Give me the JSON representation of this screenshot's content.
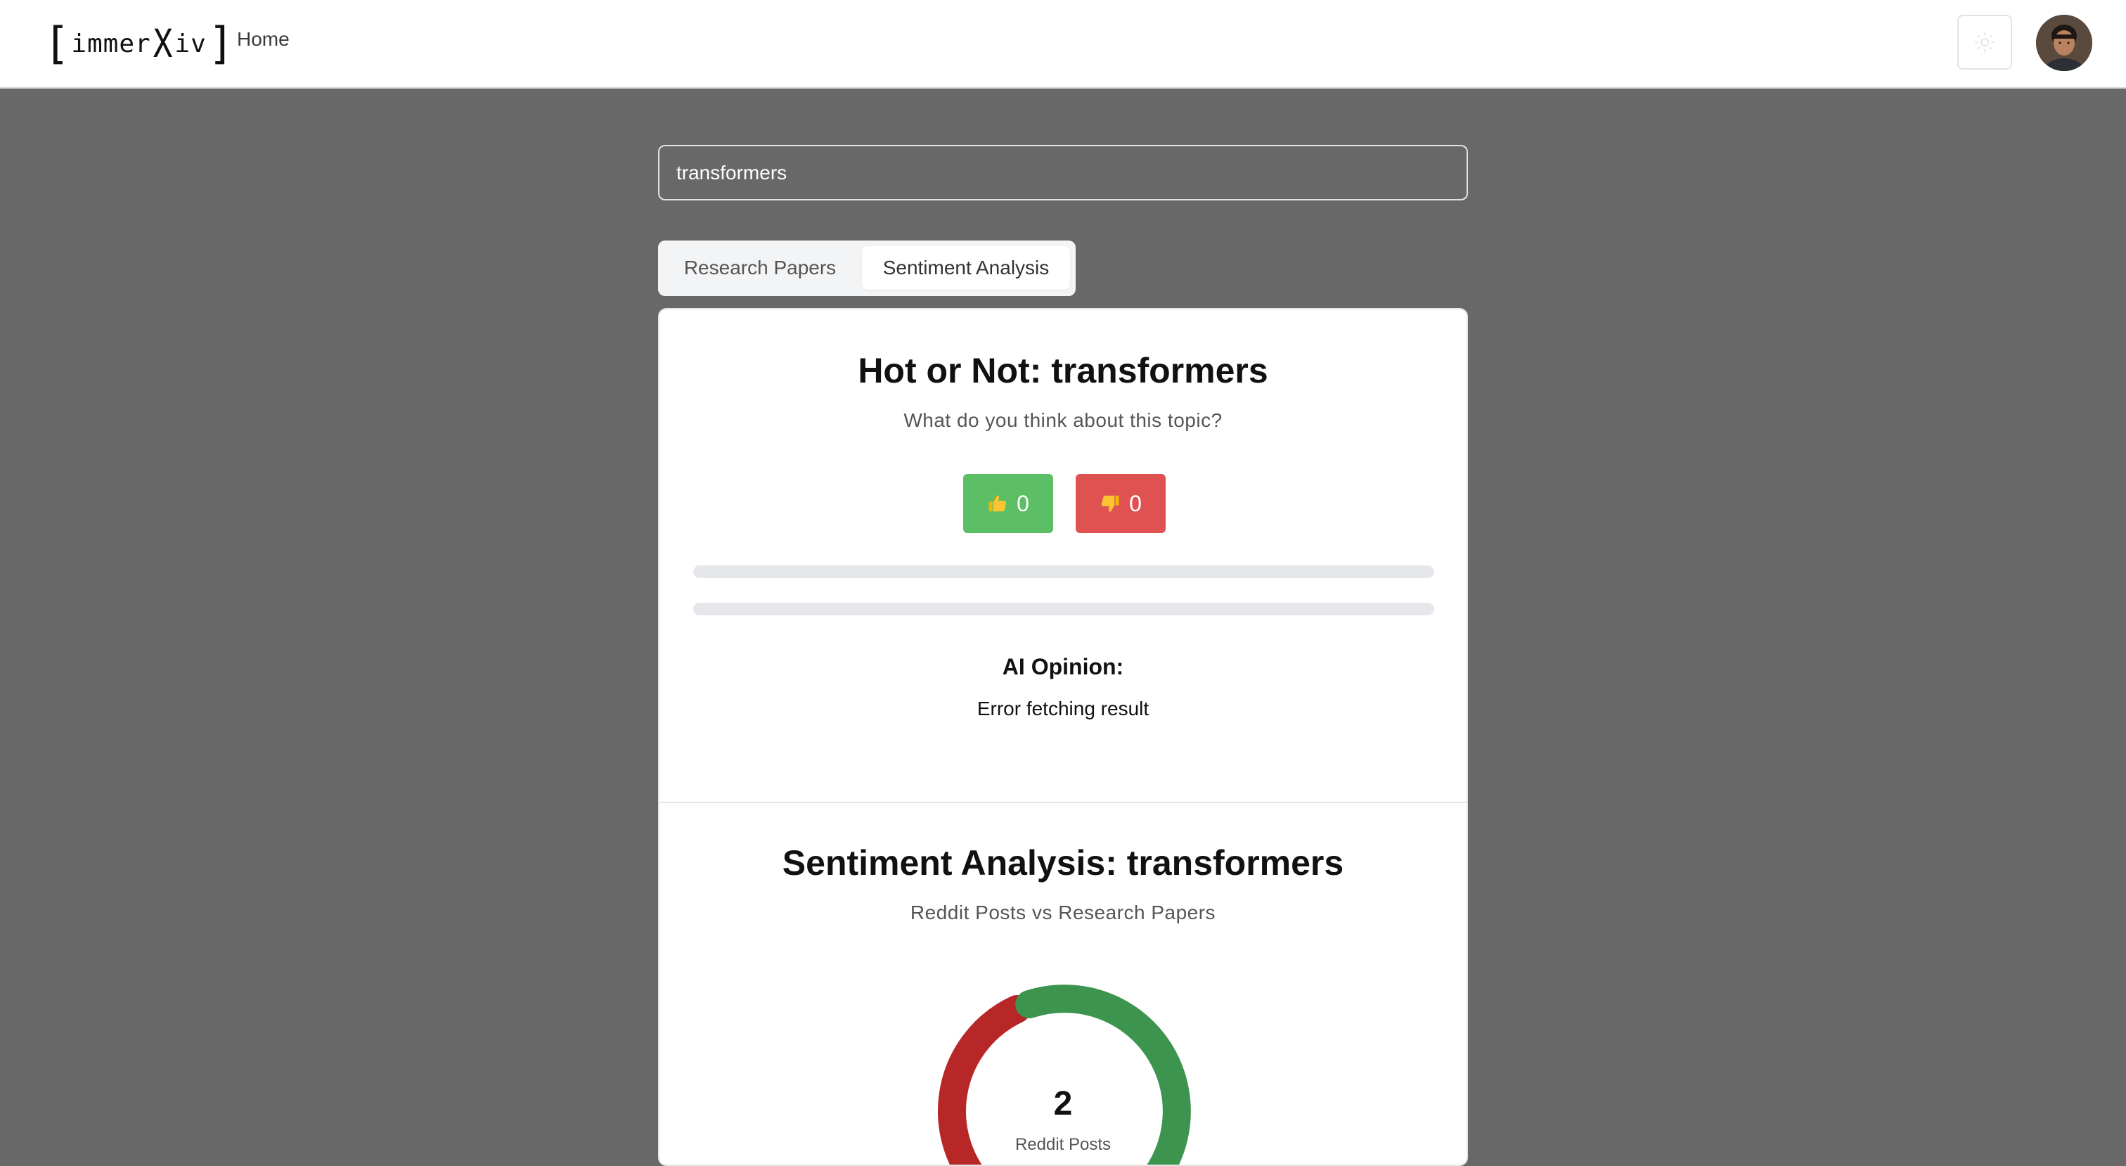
{
  "header": {
    "logo_text": "immer",
    "logo_x": "X",
    "logo_suffix": "iv",
    "nav_home": "Home",
    "theme_icon": "sun-icon",
    "avatar_icon": "user-avatar"
  },
  "search": {
    "value": "transformers"
  },
  "tabs": [
    {
      "label": "Research Papers",
      "active": false
    },
    {
      "label": "Sentiment Analysis",
      "active": true
    }
  ],
  "hot_or_not": {
    "title": "Hot or Not: transformers",
    "subtitle": "What do you think about this topic?",
    "upvote": {
      "icon": "thumbs-up-icon",
      "count": "0",
      "color": "#5cbe65"
    },
    "downvote": {
      "icon": "thumbs-down-icon",
      "count": "0",
      "color": "#e05252"
    },
    "upvote_share": 0,
    "downvote_share": 0,
    "ai_heading": "AI Opinion:",
    "ai_result": "Error fetching result"
  },
  "sentiment": {
    "title": "Sentiment Analysis: transformers",
    "subtitle": "Reddit Posts vs Research Papers",
    "gauge": {
      "value": "2",
      "label": "Reddit Posts",
      "negative_color": "#b72727",
      "positive_color": "#3d944f",
      "negative_share": 0.42
    }
  }
}
